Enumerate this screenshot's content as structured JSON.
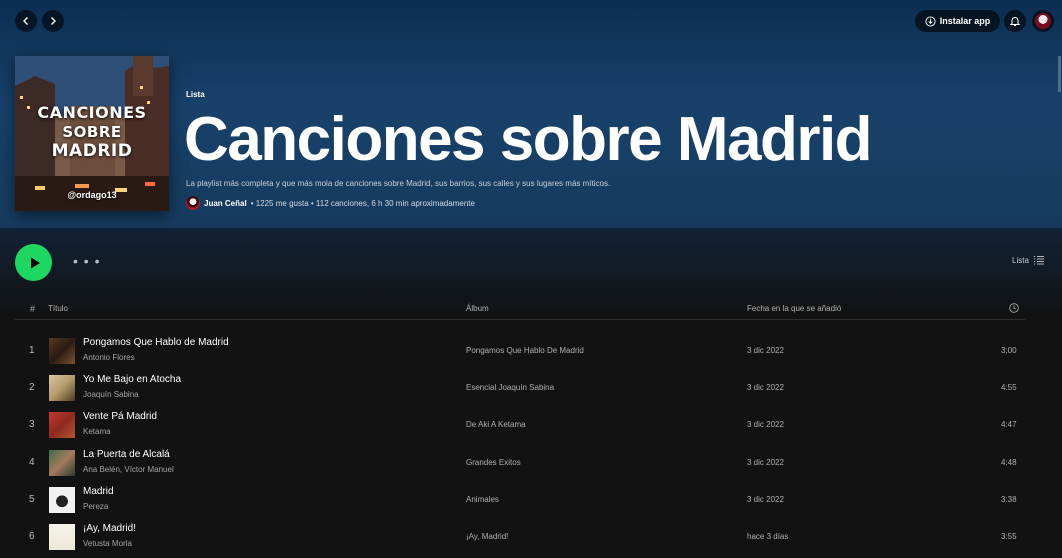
{
  "topbar": {
    "install_label": "Instalar app",
    "icons": [
      "chevron-left-icon",
      "chevron-right-icon",
      "download-icon",
      "bell-icon",
      "user-avatar"
    ]
  },
  "playlist": {
    "cover_title_line1": "CANCIONES",
    "cover_title_line2": "SOBRE",
    "cover_title_line3": "MADRID",
    "cover_handle": "@ordago13",
    "type": "Lista",
    "title": "Canciones sobre Madrid",
    "description": "La playlist más completa y que más mola de canciones sobre Madrid, sus barrios, sus calles y sus lugares más míticos.",
    "owner": "Juan Ceñal",
    "stats": "• 1225 me gusta • 112 canciones, 6 h 30 min aproximadamente"
  },
  "actions": {
    "more": "• • •",
    "view_label": "Lista"
  },
  "table": {
    "headers": {
      "num": "#",
      "title": "Título",
      "album": "Álbum",
      "date": "Fecha en la que se añadió"
    },
    "rows": [
      {
        "num": "1",
        "title": "Pongamos Que Hablo de Madrid",
        "artist": "Antonio Flores",
        "album": "Pongamos Que Hablo De Madrid",
        "date": "3 dic 2022",
        "duration": "3:00"
      },
      {
        "num": "2",
        "title": "Yo Me Bajo en Atocha",
        "artist": "Joaquín Sabina",
        "album": "Esencial Joaquín Sabina",
        "date": "3 dic 2022",
        "duration": "4:55"
      },
      {
        "num": "3",
        "title": "Vente Pá Madrid",
        "artist": "Ketama",
        "album": "De Aki A Ketama",
        "date": "3 dic 2022",
        "duration": "4:47"
      },
      {
        "num": "4",
        "title": "La Puerta de Alcalá",
        "artist": "Ana Belén, Víctor Manuel",
        "album": "Grandes Exitos",
        "date": "3 dic 2022",
        "duration": "4:48"
      },
      {
        "num": "5",
        "title": "Madrid",
        "artist": "Pereza",
        "album": "Animales",
        "date": "3 dic 2022",
        "duration": "3:38"
      },
      {
        "num": "6",
        "title": "¡Ay, Madrid!",
        "artist": "Vetusta Morla",
        "album": "¡Ay, Madrid!",
        "date": "hace 3 días",
        "duration": "3:55"
      }
    ]
  },
  "colors": {
    "accent": "#1ed760",
    "background": "#121212",
    "header_blue": "#18416a"
  }
}
